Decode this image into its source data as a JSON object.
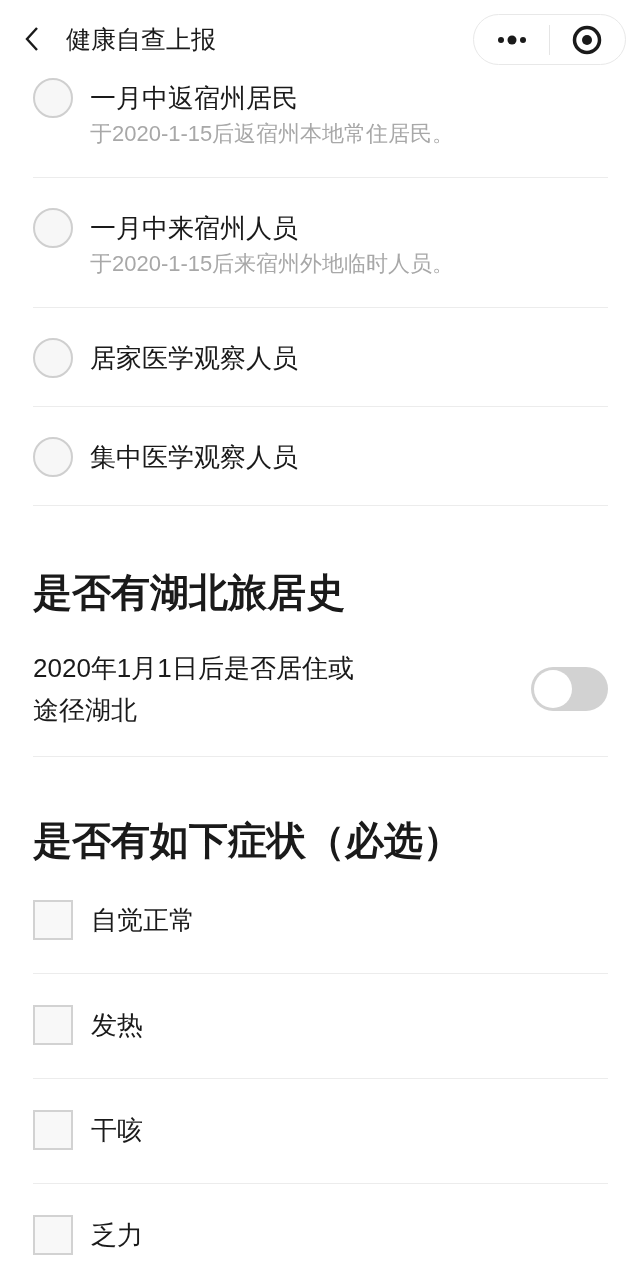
{
  "header": {
    "title": "健康自查上报"
  },
  "identity_options": [
    {
      "title": "一月中返宿州居民",
      "description": "于2020-1-15后返宿州本地常住居民。",
      "selected": false
    },
    {
      "title": "一月中来宿州人员",
      "description": "于2020-1-15后来宿州外地临时人员。",
      "selected": false
    },
    {
      "title": "居家医学观察人员",
      "selected": false
    },
    {
      "title": "集中医学观察人员",
      "selected": false
    }
  ],
  "hubei_section": {
    "heading": "是否有湖北旅居史",
    "question": "2020年1月1日后是否居住或途径湖北",
    "on": false
  },
  "symptoms_section": {
    "heading": "是否有如下症状（必选）",
    "options": [
      {
        "label": "自觉正常",
        "checked": false
      },
      {
        "label": "发热",
        "checked": false
      },
      {
        "label": "干咳",
        "checked": false
      },
      {
        "label": "乏力",
        "checked": false
      }
    ]
  }
}
